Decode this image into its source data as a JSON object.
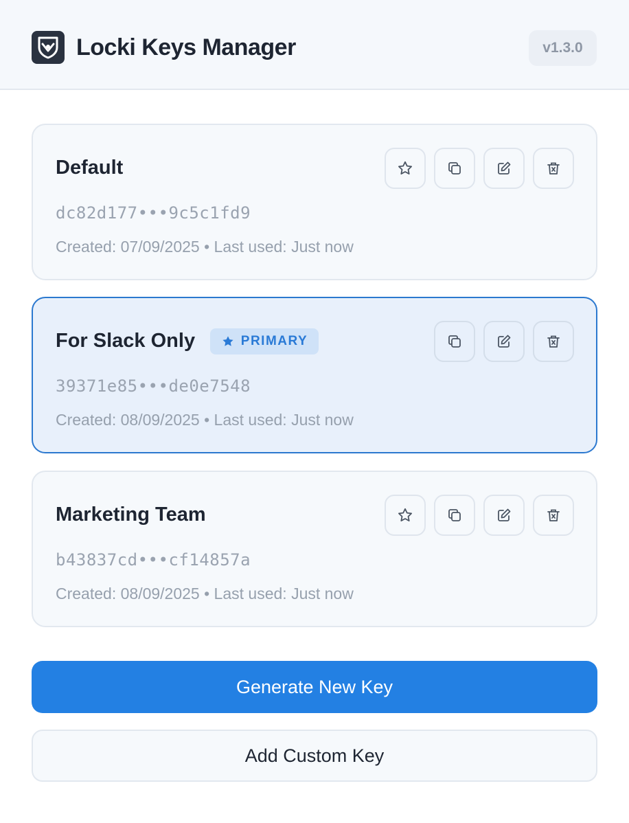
{
  "app": {
    "title": "Locki Keys Manager",
    "version": "v1.3.0",
    "logo_icon": "shield-logo-icon"
  },
  "colors": {
    "accent": "#2380e3",
    "primary_card_bg": "#e8f0fb",
    "primary_card_border": "#2b78cf",
    "card_bg": "#f6f9fc"
  },
  "keys": [
    {
      "name": "Default",
      "primary": false,
      "key": "dc82d177•••9c5c1fd9",
      "meta": "Created: 07/09/2025 • Last used: Just now",
      "actions": [
        "star-icon",
        "copy-icon",
        "edit-icon",
        "delete-icon"
      ]
    },
    {
      "name": "For Slack Only",
      "primary": true,
      "badge": "PRIMARY",
      "key": "39371e85•••de0e7548",
      "meta": "Created: 08/09/2025 • Last used: Just now",
      "actions": [
        "copy-icon",
        "edit-icon",
        "delete-icon"
      ]
    },
    {
      "name": "Marketing Team",
      "primary": false,
      "key": "b43837cd•••cf14857a",
      "meta": "Created: 08/09/2025 • Last used: Just now",
      "actions": [
        "star-icon",
        "copy-icon",
        "edit-icon",
        "delete-icon"
      ]
    }
  ],
  "buttons": {
    "generate": "Generate New Key",
    "add_custom": "Add Custom Key"
  }
}
